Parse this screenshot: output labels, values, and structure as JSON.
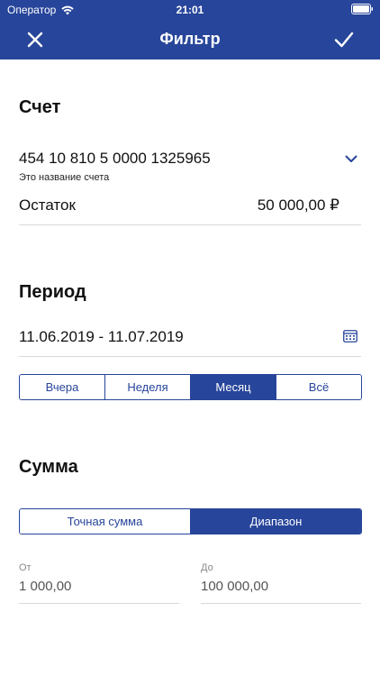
{
  "status": {
    "carrier": "Оператор",
    "time": "21:01"
  },
  "nav": {
    "title": "Фильтр"
  },
  "account": {
    "section_title": "Счет",
    "number": "454 10 810 5 0000 1325965",
    "name": "Это название счета",
    "balance_label": "Остаток",
    "balance_value": "50 000,00 ₽"
  },
  "period": {
    "section_title": "Период",
    "range": "11.06.2019 - 11.07.2019",
    "options": [
      "Вчера",
      "Неделя",
      "Месяц",
      "Всё"
    ],
    "selected": "Месяц"
  },
  "amount": {
    "section_title": "Сумма",
    "modes": [
      "Точная сумма",
      "Диапазон"
    ],
    "selected": "Диапазон",
    "from_label": "От",
    "from_value": "1 000,00",
    "to_label": "До",
    "to_value": "100 000,00"
  },
  "colors": {
    "primary": "#27459a",
    "divider": "#d8d8d8"
  },
  "icons": {
    "close": "close-icon",
    "confirm": "checkmark-icon",
    "dropdown": "chevron-down-icon",
    "calendar": "calendar-icon",
    "wifi": "wifi-icon",
    "battery": "battery-icon"
  }
}
